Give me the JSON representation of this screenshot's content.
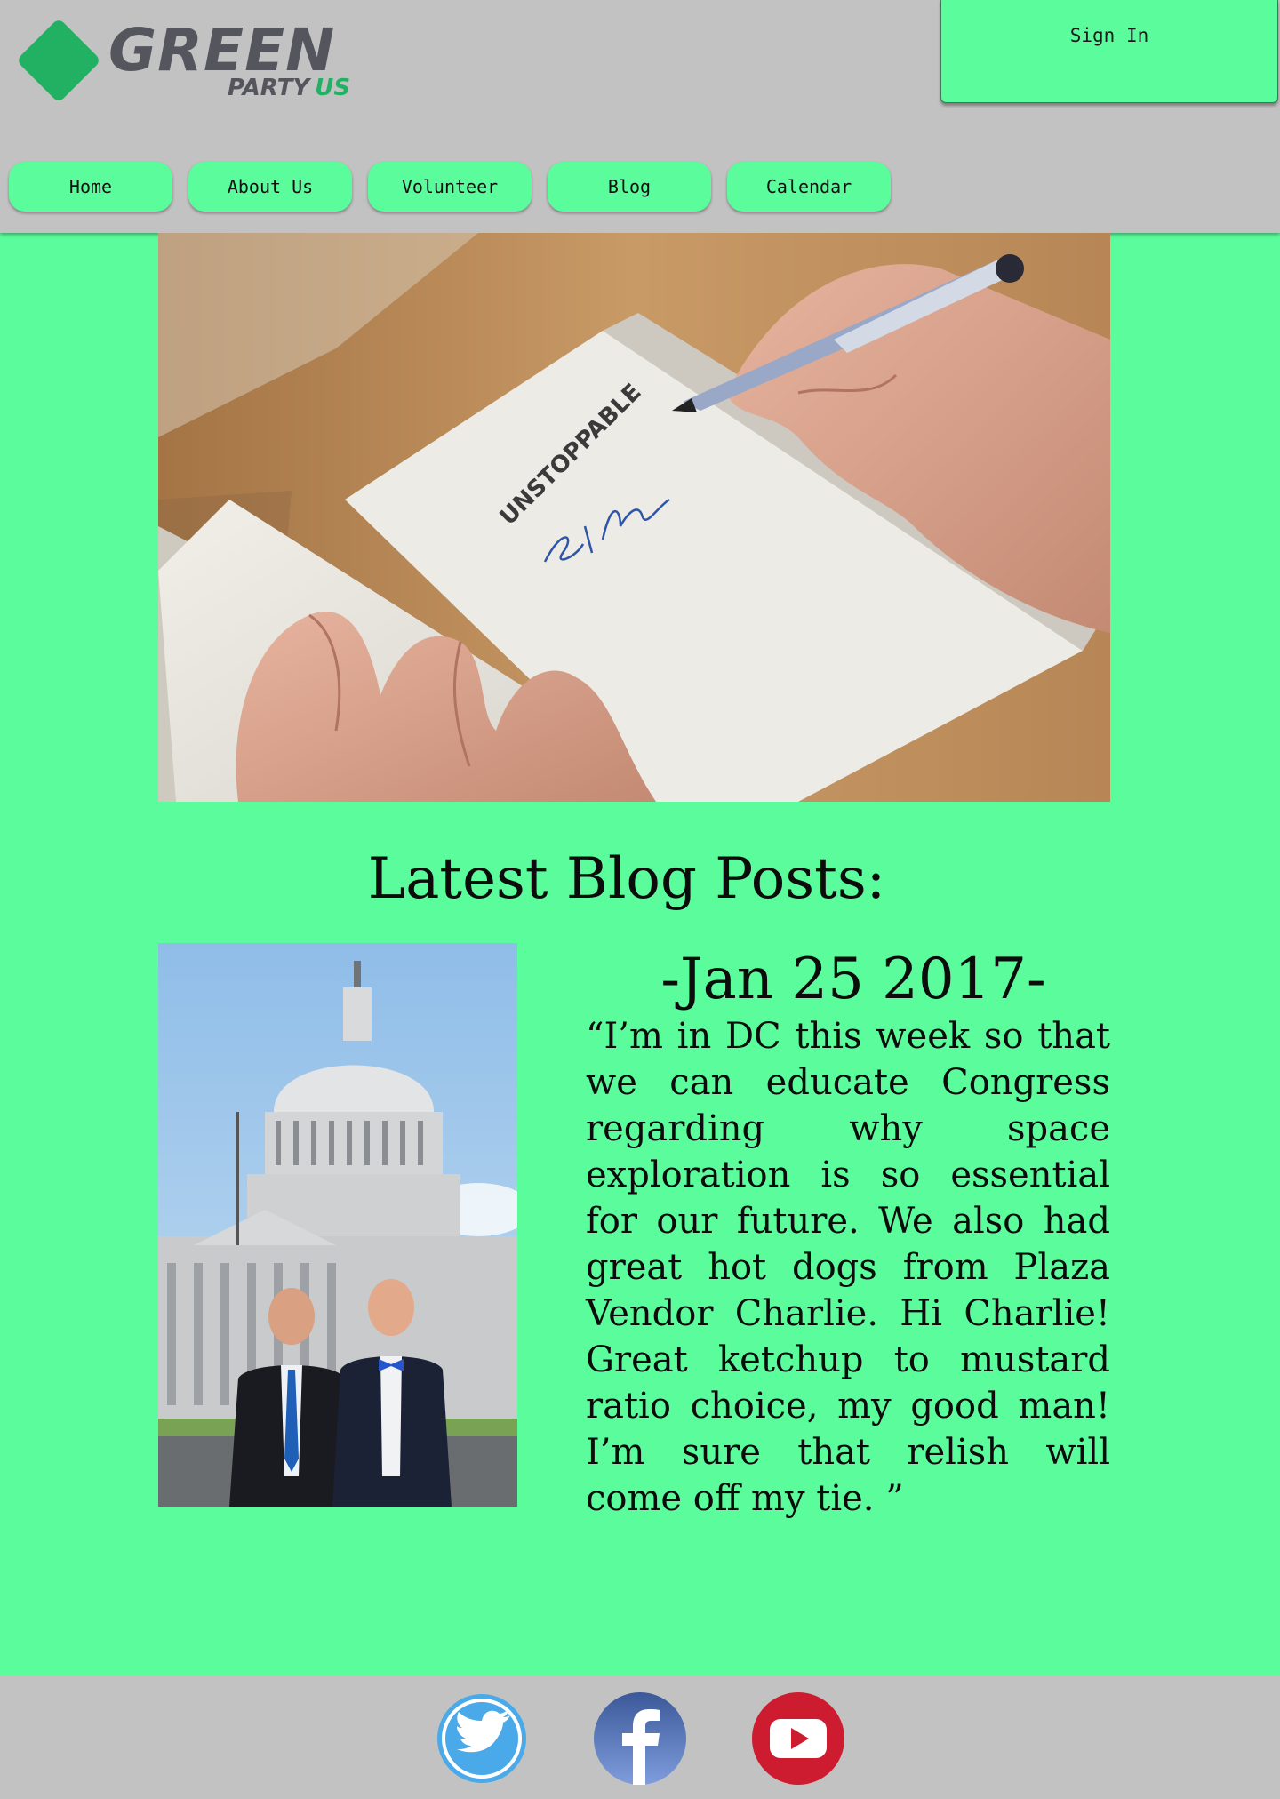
{
  "brand": {
    "logo_word": "GREEN",
    "logo_party": "PARTY",
    "logo_us": "US",
    "colors": {
      "brand_green": "#22b062",
      "page_bg": "#5bfc9c",
      "header_bg": "#c2c2c2"
    }
  },
  "header": {
    "signin_label": "Sign In"
  },
  "nav": {
    "items": [
      {
        "label": "Home"
      },
      {
        "label": "About Us"
      },
      {
        "label": "Volunteer"
      },
      {
        "label": "Blog"
      },
      {
        "label": "Calendar"
      }
    ]
  },
  "hero": {
    "book_title": "UNSTOPPABLE",
    "icon": "book-signing-photo"
  },
  "blog": {
    "heading": "Latest Blog Posts:",
    "post": {
      "date": "-Jan 25 2017-",
      "body": "“I’m in DC this week so that we can educate Congress regarding why space exploration is so essential for our future. We also had great hot dogs from  Plaza Vendor Charlie. Hi Charlie! Great ketchup to mustard ratio choice, my good man! I’m sure that relish will come off my tie. ”",
      "photo_icon": "capitol-photo"
    }
  },
  "footer": {
    "social": [
      {
        "icon": "twitter-icon",
        "color": "#4aa9e8"
      },
      {
        "icon": "facebook-icon",
        "color": "#3b5998"
      },
      {
        "icon": "youtube-icon",
        "color": "#cd1b2f"
      }
    ]
  }
}
